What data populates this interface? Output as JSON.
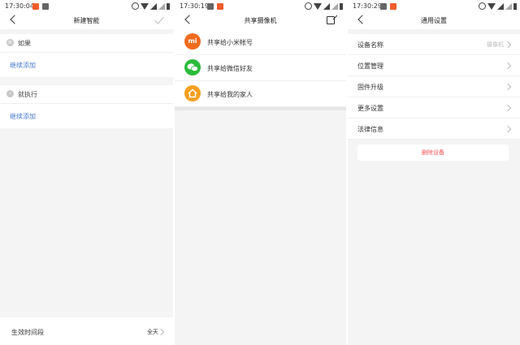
{
  "screen1": {
    "status": {
      "time": "17:30:04"
    },
    "title": "新建智能",
    "if_label": "如果",
    "if_add": "继续添加",
    "then_label": "就执行",
    "then_add": "继续添加",
    "period_label": "生效时间段",
    "period_value": "全天"
  },
  "screen2": {
    "status": {
      "time": "17:30:19"
    },
    "title": "共享摄像机",
    "items": [
      {
        "label": "共享给小米帐号",
        "icon": "mi-icon",
        "color": "#f26b1d"
      },
      {
        "label": "共享给微信好友",
        "icon": "wechat-icon",
        "color": "#2bbb3b"
      },
      {
        "label": "共享给我的家人",
        "icon": "home-icon",
        "color": "#f5a020"
      }
    ],
    "mi_glyph": "mi"
  },
  "screen3": {
    "status": {
      "time": "17:30:29"
    },
    "title": "通用设置",
    "items": [
      {
        "label": "设备名称",
        "value": "摄像机"
      },
      {
        "label": "位置管理",
        "value": ""
      },
      {
        "label": "固件升级",
        "value": ""
      },
      {
        "label": "更多设置",
        "value": ""
      },
      {
        "label": "法律信息",
        "value": ""
      }
    ],
    "delete_label": "删除设备"
  }
}
